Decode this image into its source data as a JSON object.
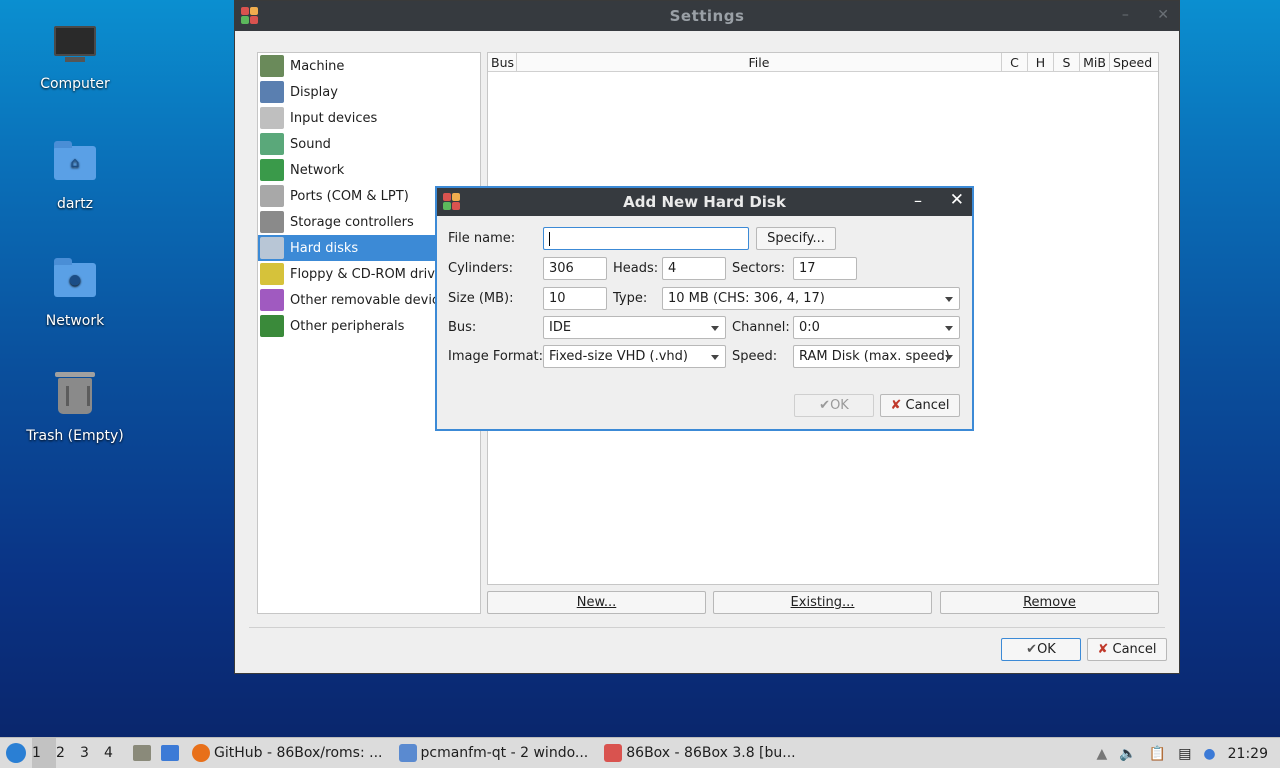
{
  "desktop": {
    "icons": [
      {
        "label": "Computer"
      },
      {
        "label": "dartz"
      },
      {
        "label": "Network"
      },
      {
        "label": "Trash (Empty)"
      }
    ]
  },
  "settings": {
    "title": "Settings",
    "nav": [
      {
        "label": "Machine",
        "icon": "machine-icon"
      },
      {
        "label": "Display",
        "icon": "display-icon"
      },
      {
        "label": "Input devices",
        "icon": "input-devices-icon"
      },
      {
        "label": "Sound",
        "icon": "sound-icon"
      },
      {
        "label": "Network",
        "icon": "network-icon"
      },
      {
        "label": "Ports (COM & LPT)",
        "icon": "ports-icon"
      },
      {
        "label": "Storage controllers",
        "icon": "storage-icon"
      },
      {
        "label": "Hard disks",
        "icon": "hard-disk-icon",
        "selected": true
      },
      {
        "label": "Floppy & CD-ROM drives",
        "icon": "floppy-cdrom-icon"
      },
      {
        "label": "Other removable devices",
        "icon": "removable-icon"
      },
      {
        "label": "Other peripherals",
        "icon": "peripherals-icon"
      }
    ],
    "columns": [
      "Bus",
      "File",
      "C",
      "H",
      "S",
      "MiB",
      "Speed"
    ],
    "buttons": {
      "new": "New...",
      "existing": "Existing...",
      "remove": "Remove"
    },
    "ok": "OK",
    "cancel": "Cancel"
  },
  "dialog": {
    "title": "Add New Hard Disk",
    "file_name_label": "File name:",
    "file_name_value": "",
    "specify": "Specify...",
    "cylinders_label": "Cylinders:",
    "cylinders": "306",
    "heads_label": "Heads:",
    "heads": "4",
    "sectors_label": "Sectors:",
    "sectors": "17",
    "size_label": "Size (MB):",
    "size": "10",
    "type_label": "Type:",
    "type": "10 MB (CHS: 306, 4, 17)",
    "bus_label": "Bus:",
    "bus": "IDE",
    "channel_label": "Channel:",
    "channel": "0:0",
    "format_label": "Image Format:",
    "format": "Fixed-size VHD (.vhd)",
    "speed_label": "Speed:",
    "speed": "RAM Disk (max. speed)",
    "ok": "OK",
    "cancel": "Cancel"
  },
  "taskbar": {
    "workspaces": [
      "1",
      "2",
      "3",
      "4"
    ],
    "tasks": [
      {
        "label": "GitHub - 86Box/roms: ..."
      },
      {
        "label": "pcmanfm-qt - 2 windo..."
      },
      {
        "label": "86Box - 86Box 3.8 [bu..."
      }
    ],
    "clock": "21:29"
  }
}
